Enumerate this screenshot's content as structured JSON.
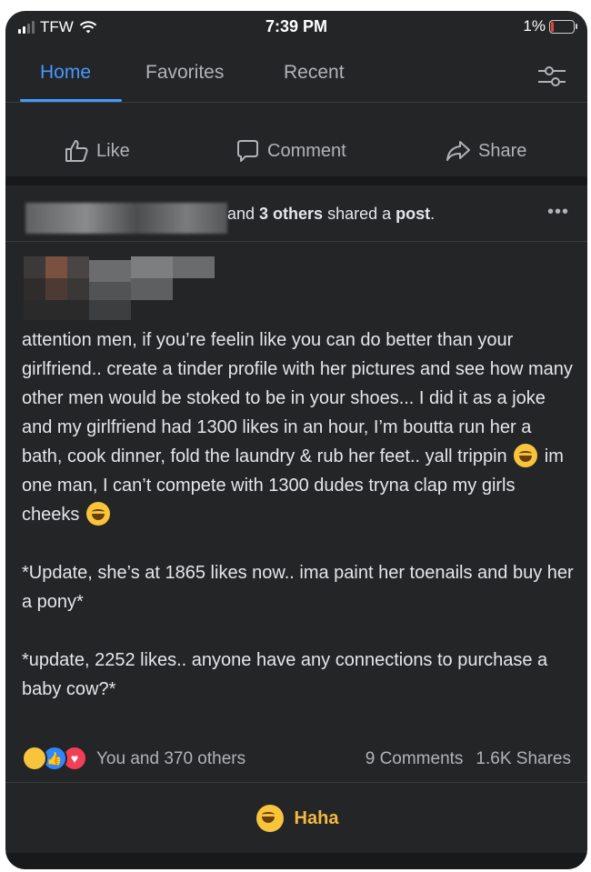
{
  "status_bar": {
    "carrier": "TFW",
    "time": "7:39 PM",
    "battery": "1%"
  },
  "tabs": [
    {
      "label": "Home",
      "active": true
    },
    {
      "label": "Favorites",
      "active": false
    },
    {
      "label": "Recent",
      "active": false
    }
  ],
  "actions": {
    "like": "Like",
    "comment": "Comment",
    "share": "Share"
  },
  "shared": {
    "prefix": "and ",
    "others": "3 others",
    "middle": " shared a ",
    "post": "post",
    "suffix": "."
  },
  "post": {
    "p1": "attention men, if you’re feelin like you can do better than your girlfriend.. create a tinder profile with her pictures and see how many other men would be stoked to be in your shoes... I did it as a joke and my girlfriend had 1300 likes in an hour, I’m boutta run her a bath, cook dinner, fold the laundry & rub her feet.. yall trippin",
    "p1b": " im one man, I can’t compete with 1300 dudes tryna clap my girls cheeks",
    "p2": "*Update, she’s at 1865 likes now.. ima paint her toenails and buy her a pony*",
    "p3": "*update, 2252 likes.. anyone have any connections to purchase a baby cow?*"
  },
  "reactions": {
    "summary": "You and 370 others",
    "comments": "9 Comments",
    "shares": "1.6K Shares"
  },
  "my_reaction": "Haha",
  "colors": {
    "accent": "#4599ff",
    "background": "#242526",
    "haha": "#f5b840",
    "like_blue": "#2d88ff",
    "love_red": "#f33e58"
  }
}
